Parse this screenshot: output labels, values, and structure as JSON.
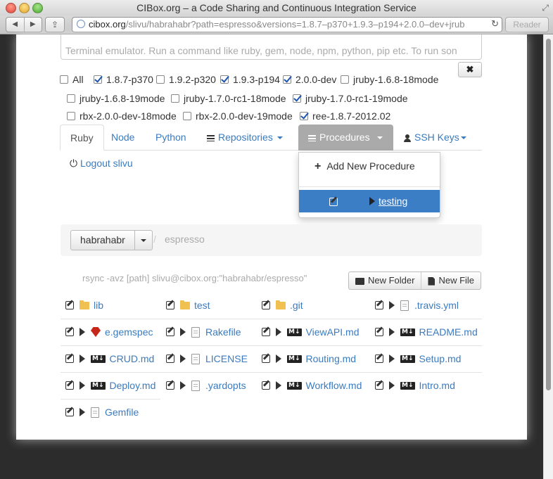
{
  "window": {
    "title": "CIBox.org – a Code Sharing and Continuous Integration Service",
    "url_host": "cibox.org",
    "url_path": "/slivu/habrahabr?path=espresso&versions=1.8.7–p370+1.9.3–p194+2.0.0–dev+jrub",
    "reader_label": "Reader"
  },
  "terminal": {
    "placeholder": "Terminal emulator. Run a command like ruby, gem, node, npm, python, pip etc. To run son",
    "close_label": "✖"
  },
  "versions": [
    {
      "label": "All",
      "checked": false
    },
    {
      "label": "1.8.7-p370",
      "checked": true
    },
    {
      "label": "1.9.2-p320",
      "checked": false
    },
    {
      "label": "1.9.3-p194",
      "checked": true
    },
    {
      "label": "2.0.0-dev",
      "checked": true
    },
    {
      "label": "jruby-1.6.8-18mode",
      "checked": false
    },
    {
      "label": "jruby-1.6.8-19mode",
      "checked": false
    },
    {
      "label": "jruby-1.7.0-rc1-18mode",
      "checked": false
    },
    {
      "label": "jruby-1.7.0-rc1-19mode",
      "checked": true
    },
    {
      "label": "rbx-2.0.0-dev-18mode",
      "checked": false
    },
    {
      "label": "rbx-2.0.0-dev-19mode",
      "checked": false
    },
    {
      "label": "ree-1.8.7-2012.02",
      "checked": true
    }
  ],
  "tabs": {
    "ruby": "Ruby",
    "node": "Node",
    "python": "Python",
    "repositories": "Repositories",
    "procedures": "Procedures",
    "ssh_keys": "SSH Keys"
  },
  "logout": "Logout slivu",
  "procedures_menu": {
    "add": "Add New Procedure",
    "item": "testing"
  },
  "breadcrumb": {
    "repo": "habrahabr",
    "separator": "/",
    "path": "espresso"
  },
  "rsync_hint": "rsync -avz [path] slivu@cibox.org:\"habrahabr/espresso\"",
  "buttons": {
    "new_folder": "New Folder",
    "new_file": "New File"
  },
  "files": [
    {
      "name": "lib",
      "type": "folder"
    },
    {
      "name": "test",
      "type": "folder"
    },
    {
      "name": ".git",
      "type": "folder"
    },
    {
      "name": ".travis.yml",
      "type": "doc"
    },
    {
      "name": "e.gemspec",
      "type": "gem"
    },
    {
      "name": "Rakefile",
      "type": "doc"
    },
    {
      "name": "ViewAPI.md",
      "type": "md"
    },
    {
      "name": "README.md",
      "type": "md"
    },
    {
      "name": "CRUD.md",
      "type": "md"
    },
    {
      "name": "LICENSE",
      "type": "doc"
    },
    {
      "name": "Routing.md",
      "type": "md"
    },
    {
      "name": "Setup.md",
      "type": "md"
    },
    {
      "name": "Deploy.md",
      "type": "md"
    },
    {
      "name": ".yardopts",
      "type": "doc"
    },
    {
      "name": "Workflow.md",
      "type": "md"
    },
    {
      "name": "Intro.md",
      "type": "md"
    },
    {
      "name": "Gemfile",
      "type": "doc"
    }
  ]
}
